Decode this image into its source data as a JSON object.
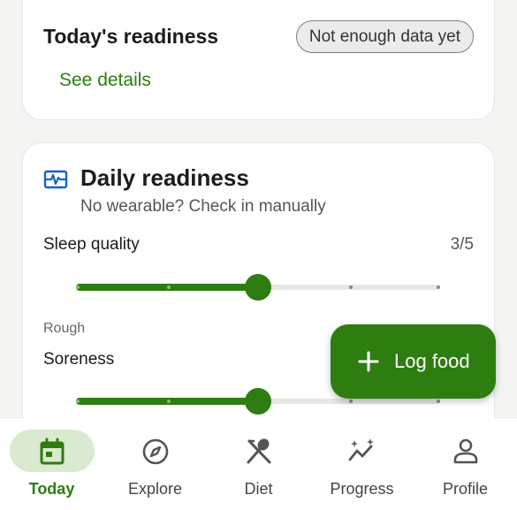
{
  "readiness": {
    "title": "Today's readiness",
    "status_chip": "Not enough data yet",
    "details_link": "See details"
  },
  "daily_readiness": {
    "icon": "monitor-heart-icon",
    "title": "Daily readiness",
    "subtitle": "No wearable? Check in manually",
    "sleep": {
      "label": "Sleep quality",
      "value_text": "3/5",
      "value": 3,
      "max": 5,
      "min_label": "Rough"
    },
    "soreness": {
      "label": "Soreness",
      "value": 3,
      "max": 5
    }
  },
  "fab": {
    "icon": "plus-icon",
    "label": "Log food"
  },
  "nav": {
    "items": [
      {
        "label": "Today",
        "icon": "calendar-icon",
        "active": true
      },
      {
        "label": "Explore",
        "icon": "compass-icon",
        "active": false
      },
      {
        "label": "Diet",
        "icon": "utensils-icon",
        "active": false
      },
      {
        "label": "Progress",
        "icon": "trend-sparkle-icon",
        "active": false
      },
      {
        "label": "Profile",
        "icon": "person-icon",
        "active": false
      }
    ]
  },
  "colors": {
    "accent": "#2e7d10",
    "accent_light": "#d9ead0",
    "icon_blue": "#1565c0"
  }
}
